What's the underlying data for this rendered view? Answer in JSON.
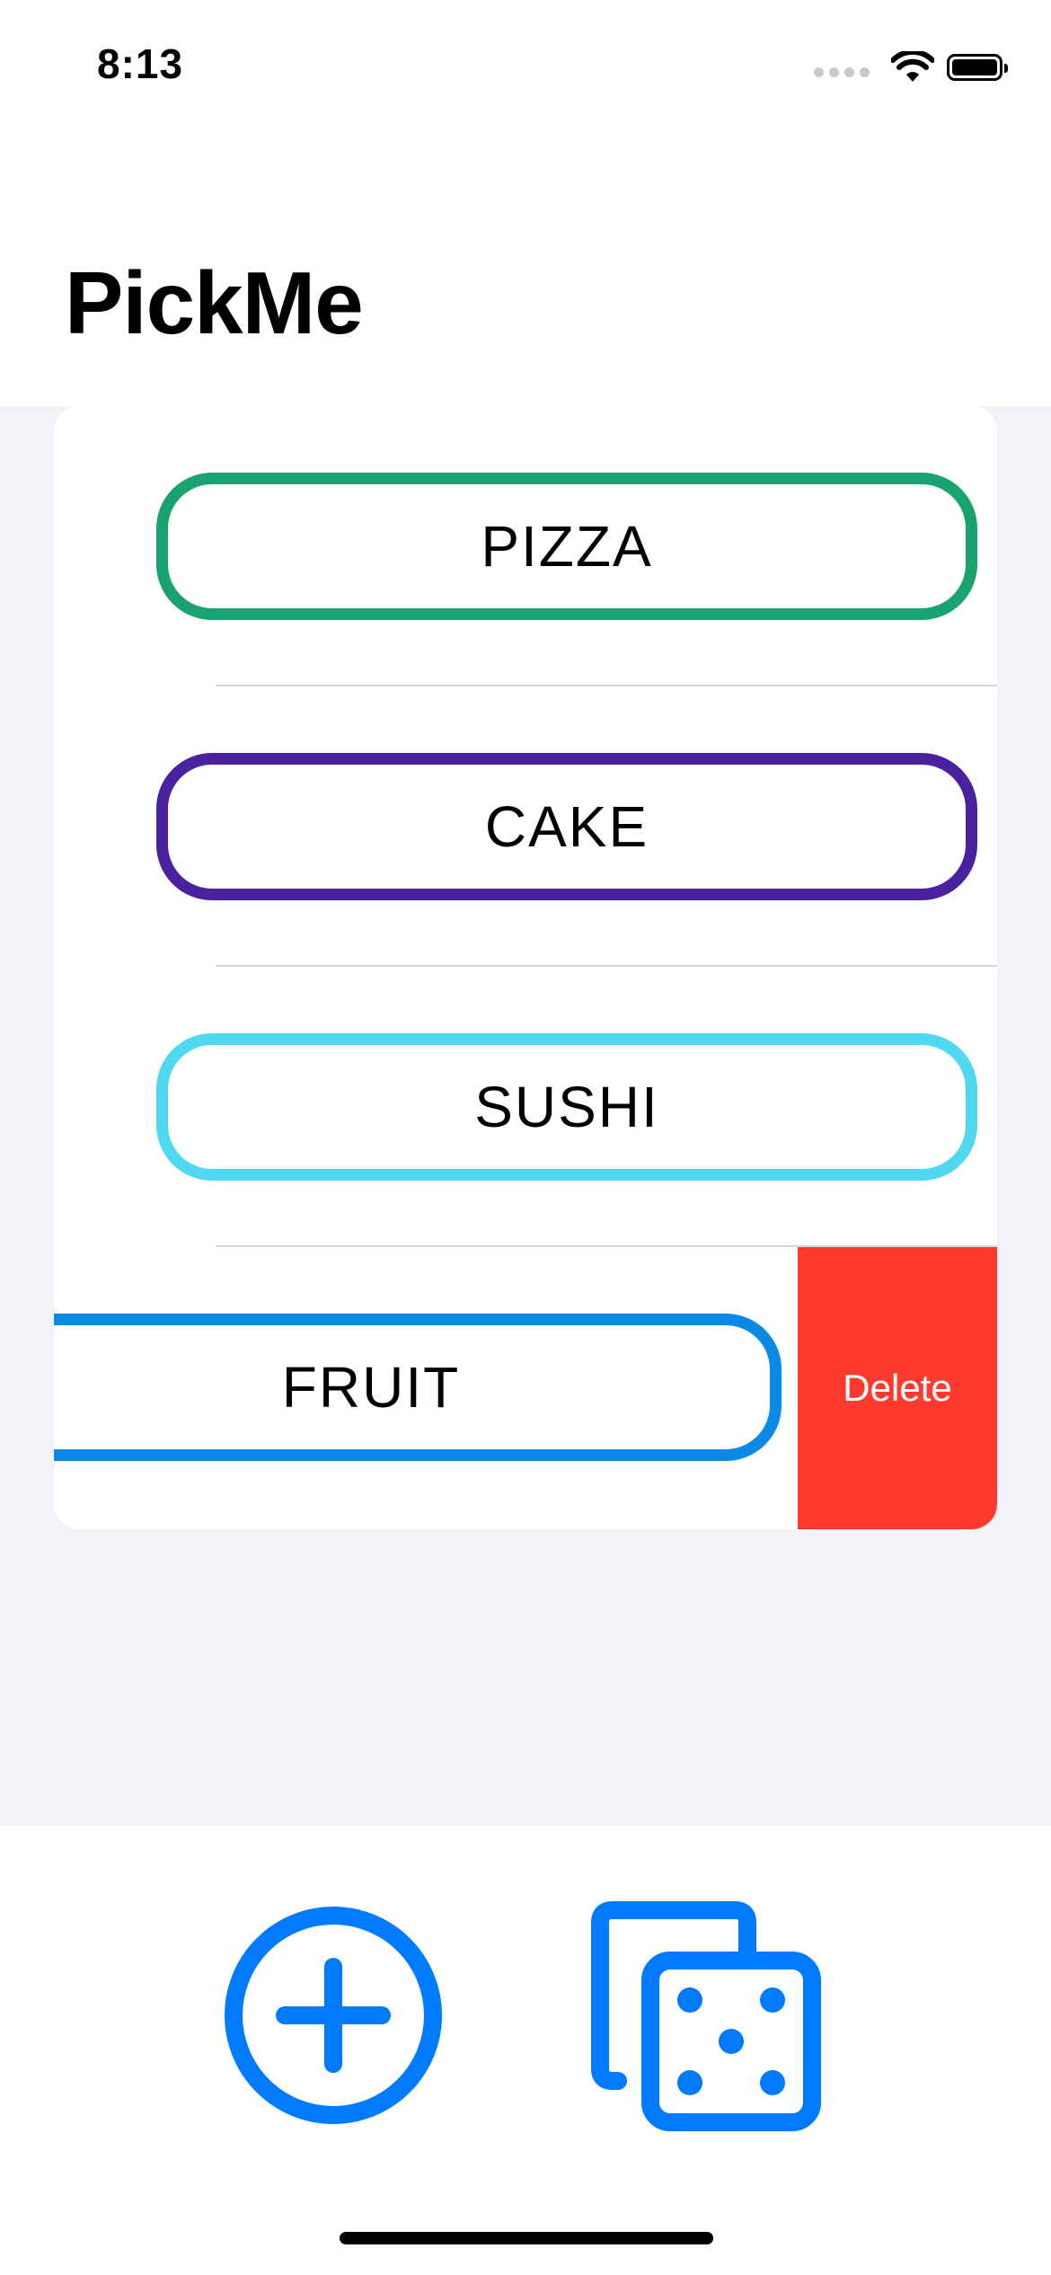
{
  "status_bar": {
    "time": "8:13"
  },
  "header": {
    "title": "PickMe"
  },
  "items": [
    {
      "label": "PIZZA",
      "color": "#1aa36f"
    },
    {
      "label": "CAKE",
      "color": "#4a22a0"
    },
    {
      "label": "SUSHI",
      "color": "#4fd8f0"
    },
    {
      "label": "FRUIT",
      "color": "#0a8ae6"
    }
  ],
  "swipe_action": {
    "label": "Delete",
    "color": "#ff3b30"
  },
  "toolbar": {
    "add_icon": "plus-circle-icon",
    "random_icon": "dice-icon",
    "accent_color": "#007aff"
  }
}
